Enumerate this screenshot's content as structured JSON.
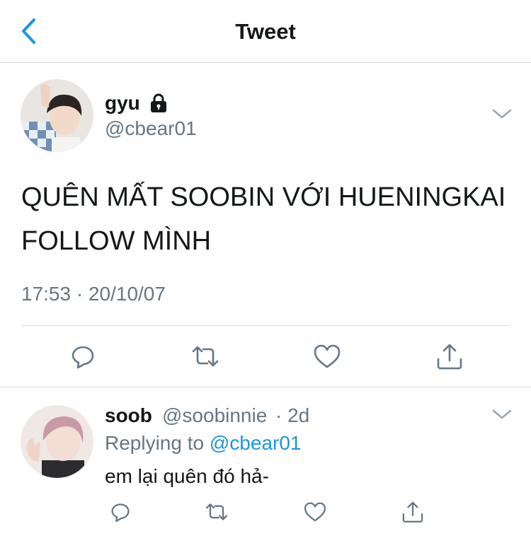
{
  "colors": {
    "accent": "#1b95e0",
    "text": "#14171a",
    "secondary": "#657786",
    "divider": "#d6dbe0"
  },
  "header": {
    "title": "Tweet",
    "back_icon": "chevron-left-icon"
  },
  "tweet": {
    "author_name": "gyu",
    "protected_icon": "lock-icon",
    "handle": "@cbear01",
    "text_line1": "QUÊN MẤT SOOBIN VỚI HUENINGKAI",
    "text_line2": "FOLLOW MÌNH",
    "timestamp": "17:53 · 20/10/07",
    "actions": [
      "reply-icon",
      "retweet-icon",
      "like-icon",
      "share-icon"
    ]
  },
  "reply": {
    "author_name": "soob",
    "handle": "@soobinnie",
    "age": "· 2d",
    "replying_to_label": "Replying to",
    "replying_to_handle": "@cbear01",
    "text": "em lại quên đó hả-",
    "actions": [
      "reply-icon",
      "retweet-icon",
      "like-icon",
      "share-icon"
    ]
  }
}
